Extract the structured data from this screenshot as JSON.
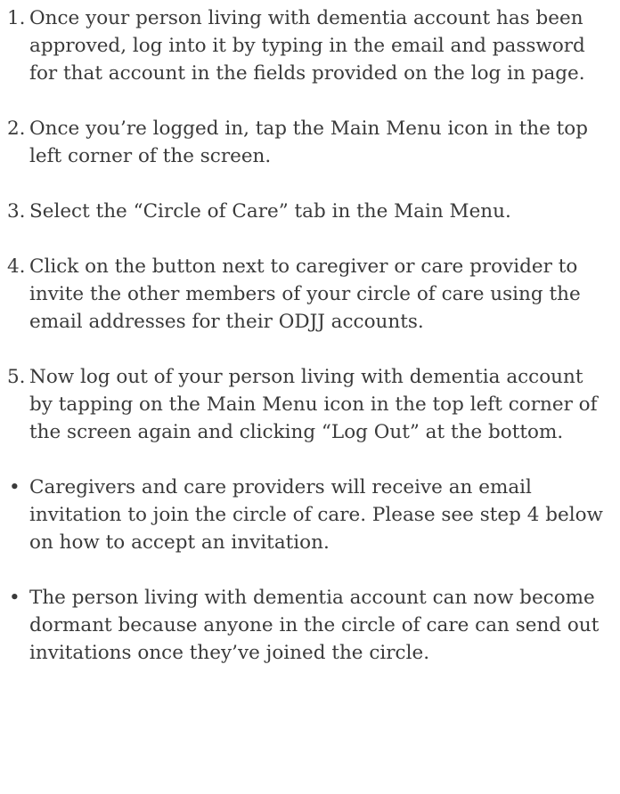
{
  "steps": [
    {
      "marker": "1.",
      "text": "Once your person living with dementia account has been approved, log into it by typing in the email and password for that account in the fields provided on the log in page."
    },
    {
      "marker": "2.",
      "text": "Once you’re logged in, tap the Main Menu icon in the top left corner of the screen."
    },
    {
      "marker": "3.",
      "text": "Select the “Circle of Care” tab in the Main Menu."
    },
    {
      "marker": "4.",
      "text": "Click on the  button next to caregiver or care provider to invite the other members of your circle of care using the email addresses for their ODJJ accounts."
    },
    {
      "marker": "5.",
      "text": "Now log out of your person living with dementia account by tapping on the Main Menu icon  in the top left corner of the screen again and clicking “Log Out” at the bottom."
    }
  ],
  "notes": [
    {
      "marker": "•",
      "text": "Caregivers and care providers will receive an email invitation to join the circle of care. Please see step 4 below on how to accept an invitation."
    },
    {
      "marker": "•",
      "text": "The person living with dementia account can now become dormant because anyone in the circle of care can send out invitations once they’ve joined the circle."
    }
  ]
}
